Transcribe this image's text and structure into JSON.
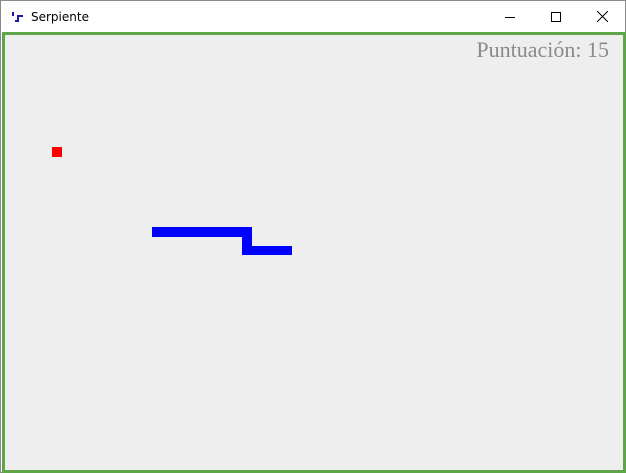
{
  "window": {
    "title": "Serpiente",
    "controls": {
      "minimize_icon": "minimize-icon",
      "maximize_icon": "maximize-icon",
      "close_icon": "close-icon"
    }
  },
  "game": {
    "score_text": "Puntuación: 15",
    "colors": {
      "background": "#eeeeee",
      "border": "#5fa64a",
      "snake": "#0000ff",
      "food": "#ff0000",
      "score": "#8a8a8a"
    }
  }
}
